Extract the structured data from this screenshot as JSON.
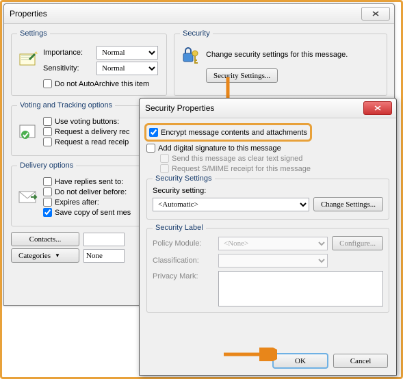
{
  "props": {
    "title": "Properties",
    "settings": {
      "legend": "Settings",
      "importance_label": "Importance:",
      "importance_value": "Normal",
      "sensitivity_label": "Sensitivity:",
      "sensitivity_value": "Normal",
      "autoarchive": "Do not AutoArchive this item"
    },
    "security": {
      "legend": "Security",
      "desc": "Change security settings for this message.",
      "btn": "Security Settings..."
    },
    "voting": {
      "legend": "Voting and Tracking options",
      "use_voting": "Use voting buttons:",
      "req_delivery": "Request a delivery rec",
      "req_read": "Request a read receip"
    },
    "delivery": {
      "legend": "Delivery options",
      "replies": "Have replies sent to:",
      "nodeliver": "Do not deliver before:",
      "expires": "Expires after:",
      "savecopy": "Save copy of sent mes"
    },
    "contacts_btn": "Contacts...",
    "categories_btn": "Categories",
    "categories_value": "None"
  },
  "sec": {
    "title": "Security Properties",
    "encrypt": "Encrypt message contents and attachments",
    "sign": "Add digital signature to this message",
    "cleartext": "Send this message as clear text signed",
    "smime": "Request S/MIME receipt for this message",
    "settings": {
      "legend": "Security Settings",
      "label": "Security setting:",
      "value": "<Automatic>",
      "change_btn": "Change Settings..."
    },
    "label": {
      "legend": "Security Label",
      "policy_label": "Policy Module:",
      "policy_value": "<None>",
      "configure_btn": "Configure...",
      "classification_label": "Classification:",
      "privacy_label": "Privacy Mark:"
    },
    "ok": "OK",
    "cancel": "Cancel"
  }
}
